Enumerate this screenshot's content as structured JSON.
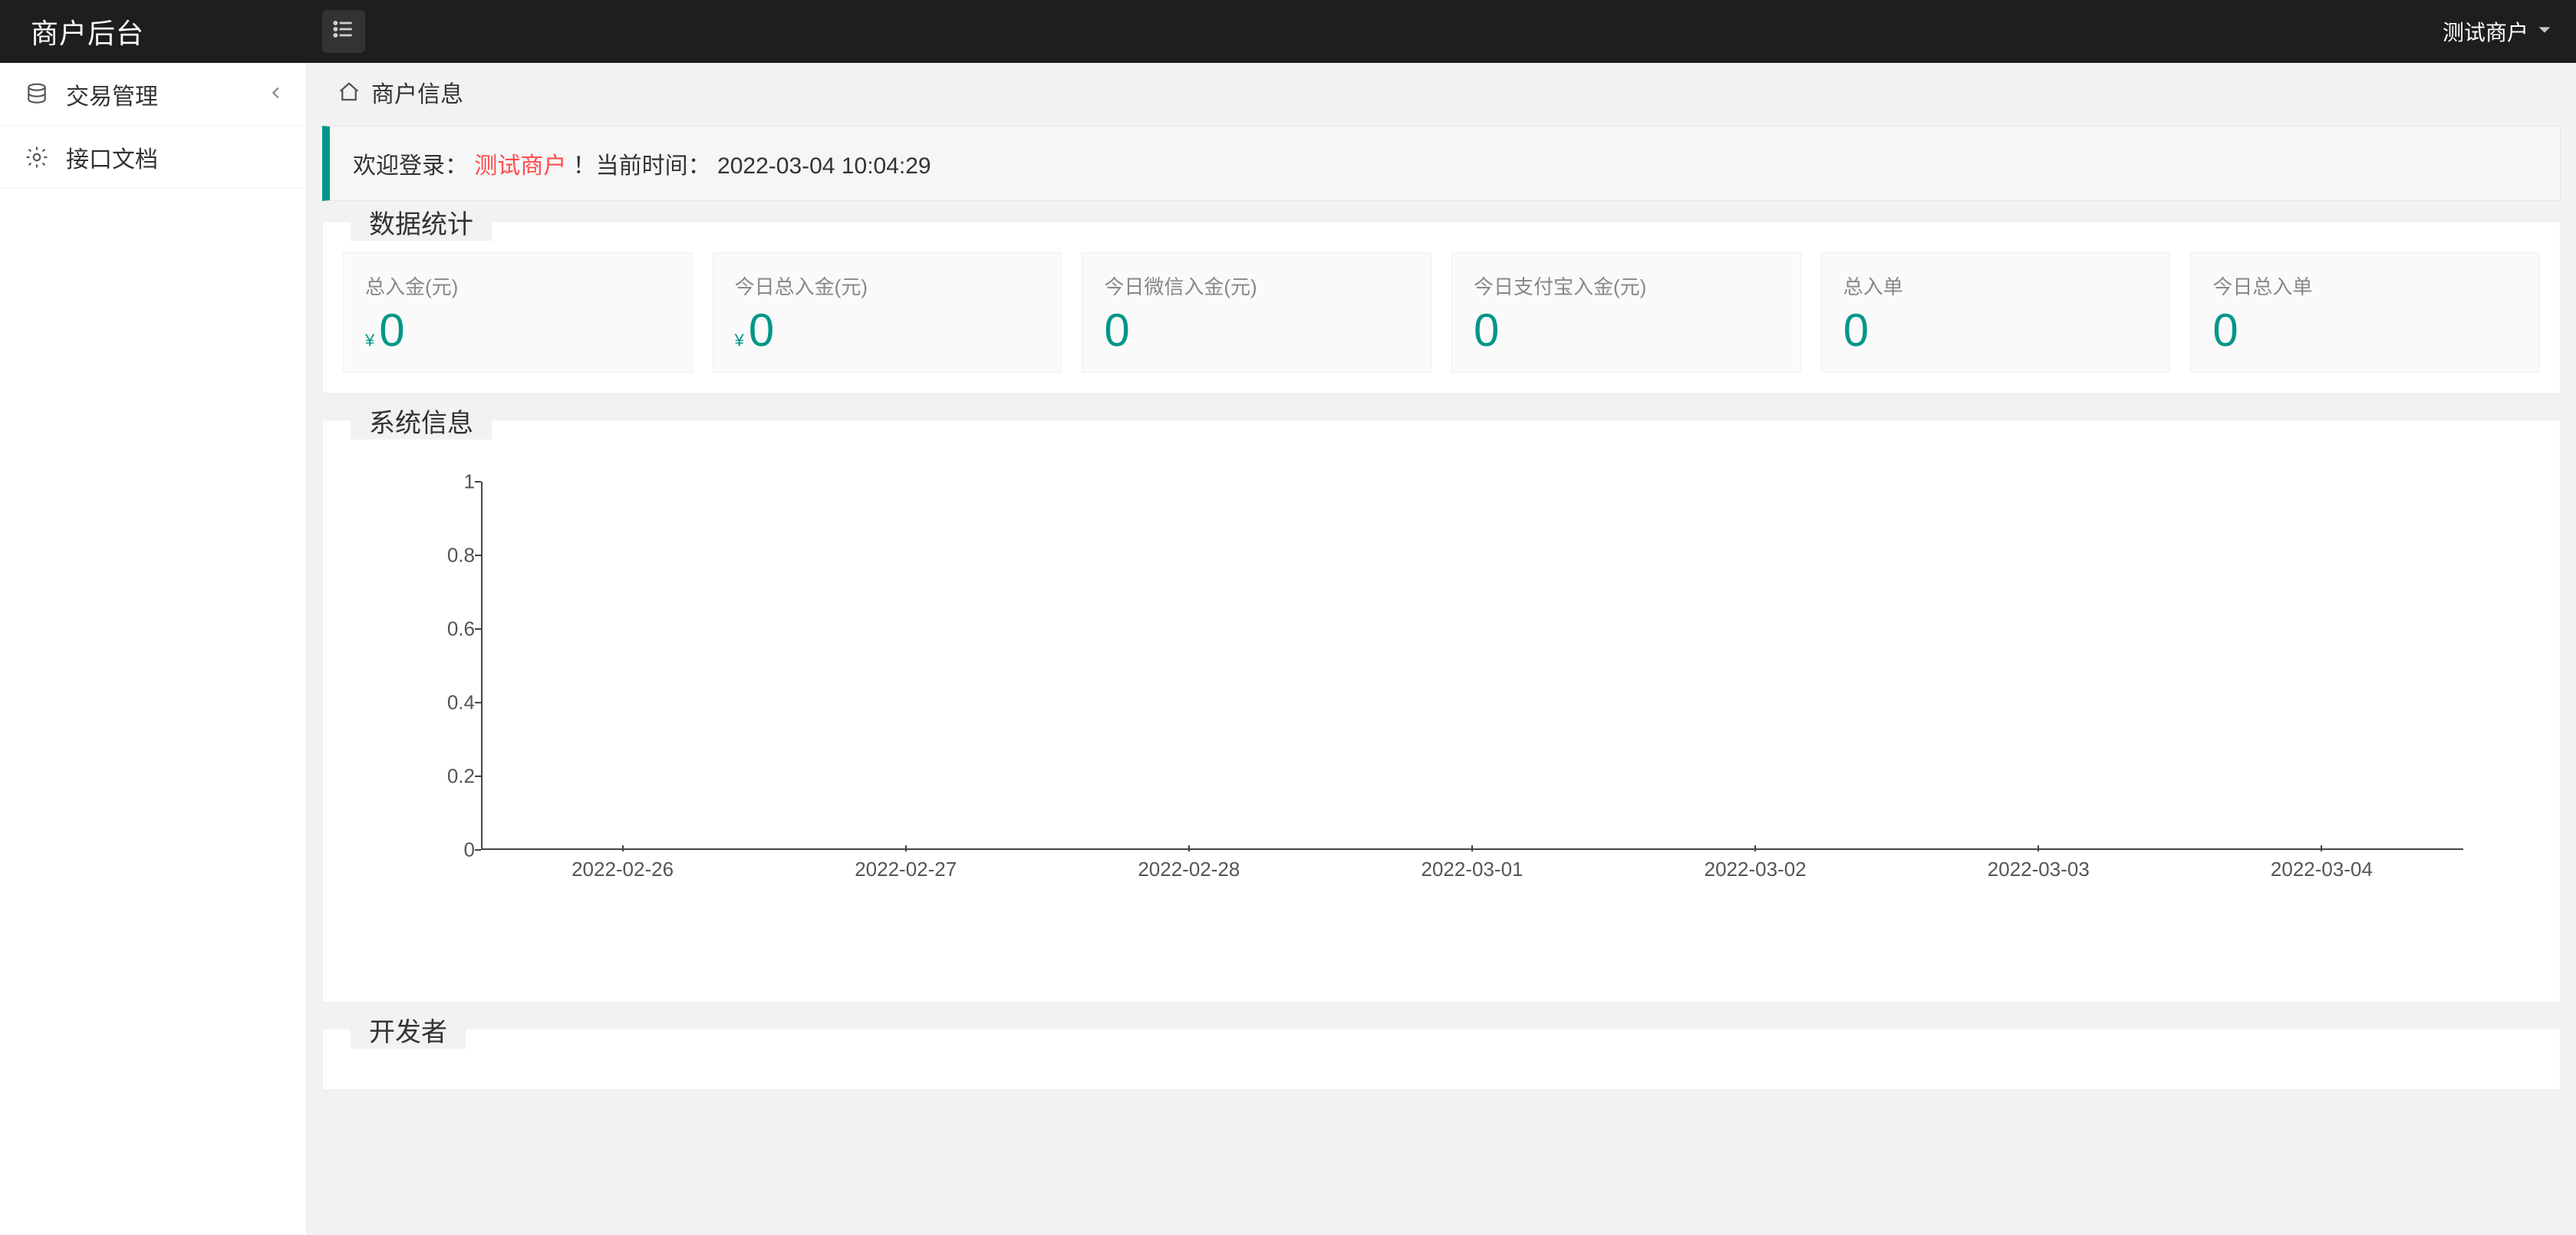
{
  "header": {
    "logo": "商户后台",
    "user": "测试商户"
  },
  "sidebar": {
    "items": [
      {
        "label": "交易管理",
        "expandable": true
      },
      {
        "label": "接口文档",
        "expandable": false
      }
    ]
  },
  "breadcrumb": {
    "title": "商户信息"
  },
  "alert": {
    "welcome_prefix": "欢迎登录：",
    "merchant": "测试商户",
    "welcome_suffix": "！当前时间：",
    "timestamp": "2022-03-04 10:04:29"
  },
  "stats_section": {
    "title": "数据统计"
  },
  "stats": [
    {
      "label": "总入金(元)",
      "value": "0",
      "yen": true
    },
    {
      "label": "今日总入金(元)",
      "value": "0",
      "yen": true
    },
    {
      "label": "今日微信入金(元)",
      "value": "0",
      "yen": false
    },
    {
      "label": "今日支付宝入金(元)",
      "value": "0",
      "yen": false
    },
    {
      "label": "总入单",
      "value": "0",
      "yen": false
    },
    {
      "label": "今日总入单",
      "value": "0",
      "yen": false
    }
  ],
  "sys_section": {
    "title": "系统信息"
  },
  "dev_section": {
    "title": "开发者"
  },
  "chart_data": {
    "type": "line",
    "title": "",
    "xlabel": "",
    "ylabel": "",
    "ylim": [
      0,
      1
    ],
    "yticks": [
      0,
      0.2,
      0.4,
      0.6,
      0.8,
      1
    ],
    "categories": [
      "2022-02-26",
      "2022-02-27",
      "2022-02-28",
      "2022-03-01",
      "2022-03-02",
      "2022-03-03",
      "2022-03-04"
    ],
    "series": [
      {
        "name": "",
        "values": [
          0,
          0,
          0,
          0,
          0,
          0,
          0
        ]
      }
    ]
  },
  "colors": {
    "accent": "#009688"
  }
}
